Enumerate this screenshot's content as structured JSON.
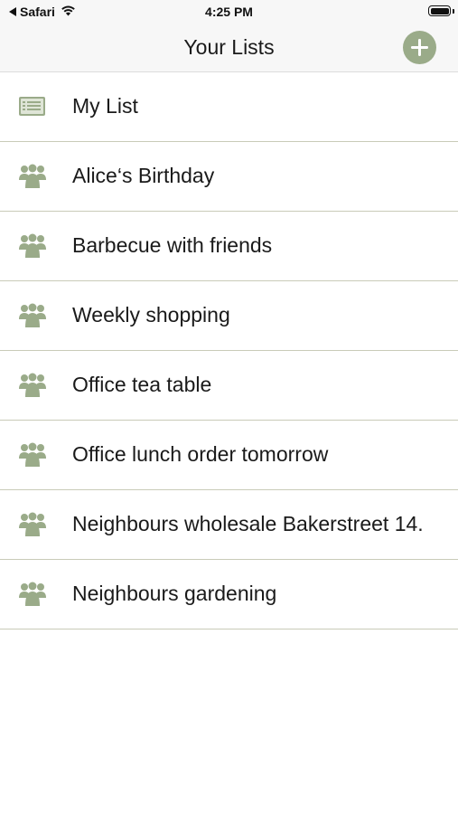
{
  "status_bar": {
    "back_app": "Safari",
    "time": "4:25 PM"
  },
  "nav": {
    "title": "Your Lists",
    "add_icon": "plus-circle-icon"
  },
  "colors": {
    "accent": "#9aab89",
    "divider": "#c9cbb8",
    "nav_background": "#f7f7f7"
  },
  "lists": [
    {
      "label": "My List",
      "icon": "list-icon"
    },
    {
      "label": "Alice‘s Birthday",
      "icon": "group-icon"
    },
    {
      "label": "Barbecue with friends",
      "icon": "group-icon"
    },
    {
      "label": "Weekly shopping",
      "icon": "group-icon"
    },
    {
      "label": "Office tea table",
      "icon": "group-icon"
    },
    {
      "label": "Office lunch order tomorrow",
      "icon": "group-icon"
    },
    {
      "label": "Neighbours wholesale Bakerstreet 14.",
      "icon": "group-icon"
    },
    {
      "label": "Neighbours gardening",
      "icon": "group-icon"
    }
  ]
}
